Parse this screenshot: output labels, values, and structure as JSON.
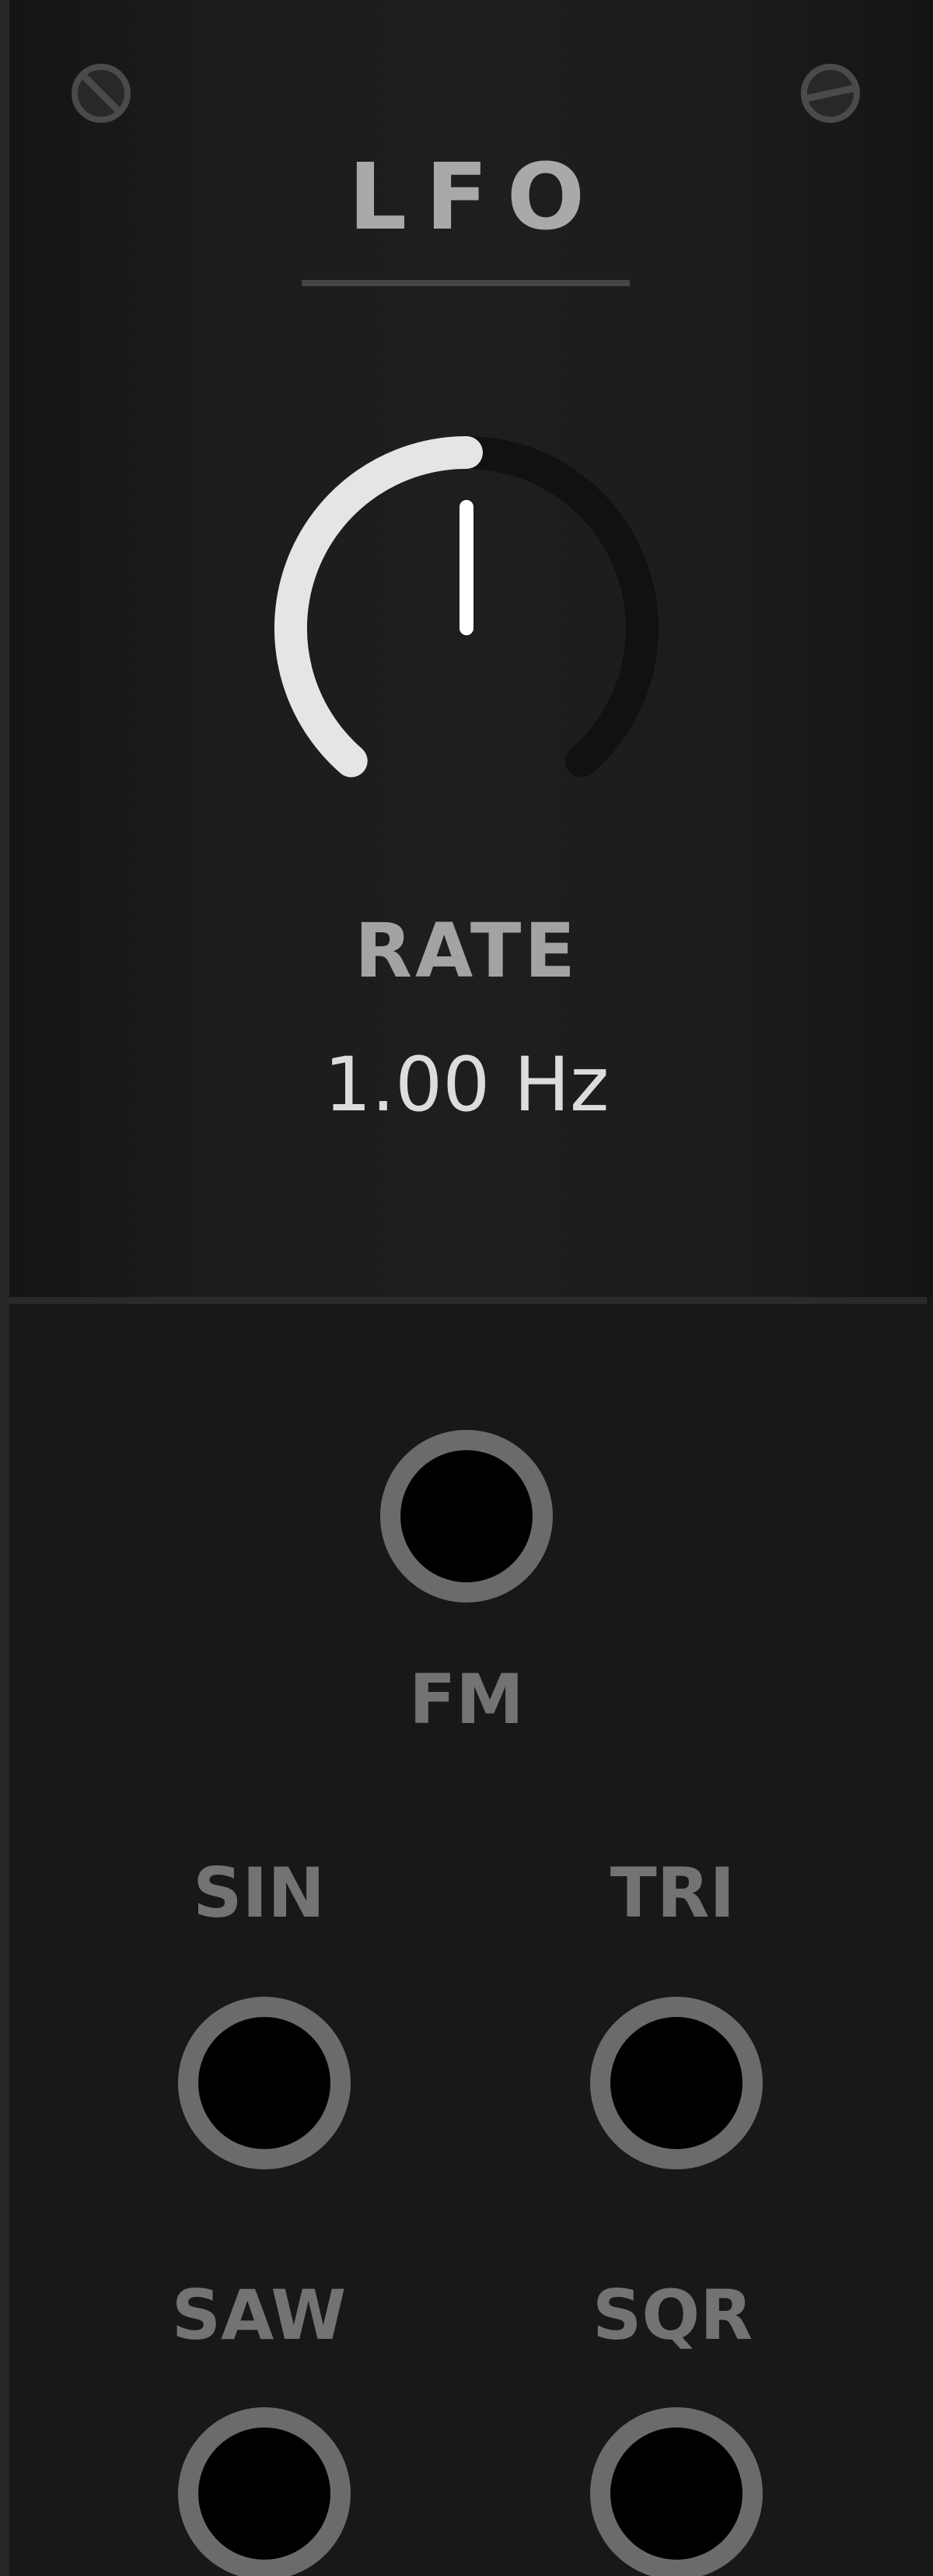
{
  "module": {
    "title": "LFO",
    "colors": {
      "panel": "#1d1d1d",
      "title": "#a9a9a9",
      "knob_arc": "#e5e5e5",
      "knob_track": "#111111",
      "jack_ring": "#6b6b6b",
      "jack_hole": "#000000",
      "jack_label": "#737373"
    }
  },
  "rate_knob": {
    "label": "RATE",
    "value_text": "1.00 Hz",
    "normalized_value": 0.5
  },
  "jacks": {
    "fm": {
      "label": "FM"
    },
    "sin": {
      "label": "SIN"
    },
    "tri": {
      "label": "TRI"
    },
    "saw": {
      "label": "SAW"
    },
    "sqr": {
      "label": "SQR"
    }
  },
  "icons": {
    "screw_left": "screw-icon",
    "screw_right": "screw-icon"
  }
}
